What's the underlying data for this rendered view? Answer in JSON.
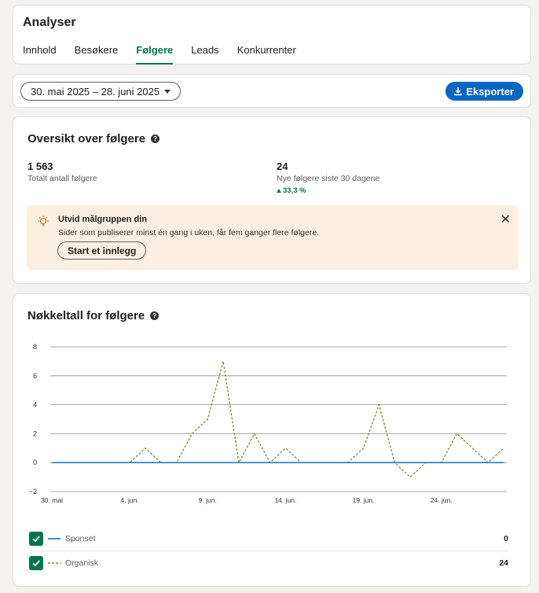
{
  "header": {
    "title": "Analyser",
    "tabs": [
      {
        "label": "Innhold",
        "active": false
      },
      {
        "label": "Besøkere",
        "active": false
      },
      {
        "label": "Følgere",
        "active": true
      },
      {
        "label": "Leads",
        "active": false
      },
      {
        "label": "Konkurrenter",
        "active": false
      }
    ]
  },
  "toolbar": {
    "date_range": "30. mai 2025 – 28. juni 2025",
    "export_label": "Eksporter"
  },
  "overview": {
    "title": "Oversikt over følgere",
    "total_value": "1 563",
    "total_label": "Totalt antall følgere",
    "new_value": "24",
    "new_label": "Nye følgere siste 30 dagene",
    "trend": "33,3 %"
  },
  "banner": {
    "title": "Utvid målgruppen din",
    "text": "Sider som publiserer minst én gang i uken, får fem ganger flere følgere.",
    "button_label": "Start et innlegg"
  },
  "metrics": {
    "title": "Nøkkeltall for følgere"
  },
  "colors": {
    "accent_green": "#01754f",
    "primary_blue": "#0a66c2",
    "sponsored_line": "#0a66c2",
    "organic_line": "#6b8e23"
  },
  "chart_data": {
    "type": "line",
    "x_tick_labels": [
      "30. mai",
      "4. jun.",
      "9. jun.",
      "14. jun.",
      "19. jun.",
      "24. jun."
    ],
    "y_ticks": [
      -2,
      0,
      2,
      4,
      6,
      8
    ],
    "ylim": [
      -2,
      8
    ],
    "grid": true,
    "x": [
      "2025-05-30",
      "2025-05-31",
      "2025-06-01",
      "2025-06-02",
      "2025-06-03",
      "2025-06-04",
      "2025-06-05",
      "2025-06-06",
      "2025-06-07",
      "2025-06-08",
      "2025-06-09",
      "2025-06-10",
      "2025-06-11",
      "2025-06-12",
      "2025-06-13",
      "2025-06-14",
      "2025-06-15",
      "2025-06-16",
      "2025-06-17",
      "2025-06-18",
      "2025-06-19",
      "2025-06-20",
      "2025-06-21",
      "2025-06-22",
      "2025-06-23",
      "2025-06-24",
      "2025-06-25",
      "2025-06-26",
      "2025-06-27",
      "2025-06-28"
    ],
    "series": [
      {
        "name": "Sponset",
        "total": "0",
        "style": "solid",
        "values": [
          0,
          0,
          0,
          0,
          0,
          0,
          0,
          0,
          0,
          0,
          0,
          0,
          0,
          0,
          0,
          0,
          0,
          0,
          0,
          0,
          0,
          0,
          0,
          0,
          0,
          0,
          0,
          0,
          0,
          0
        ]
      },
      {
        "name": "Organisk",
        "total": "24",
        "style": "dashed",
        "values": [
          0,
          0,
          0,
          0,
          0,
          0,
          1,
          0,
          0,
          2,
          3,
          7,
          0,
          2,
          0,
          1,
          0,
          0,
          0,
          0,
          1,
          4,
          0,
          -1,
          0,
          0,
          2,
          1,
          0,
          1
        ]
      }
    ]
  }
}
